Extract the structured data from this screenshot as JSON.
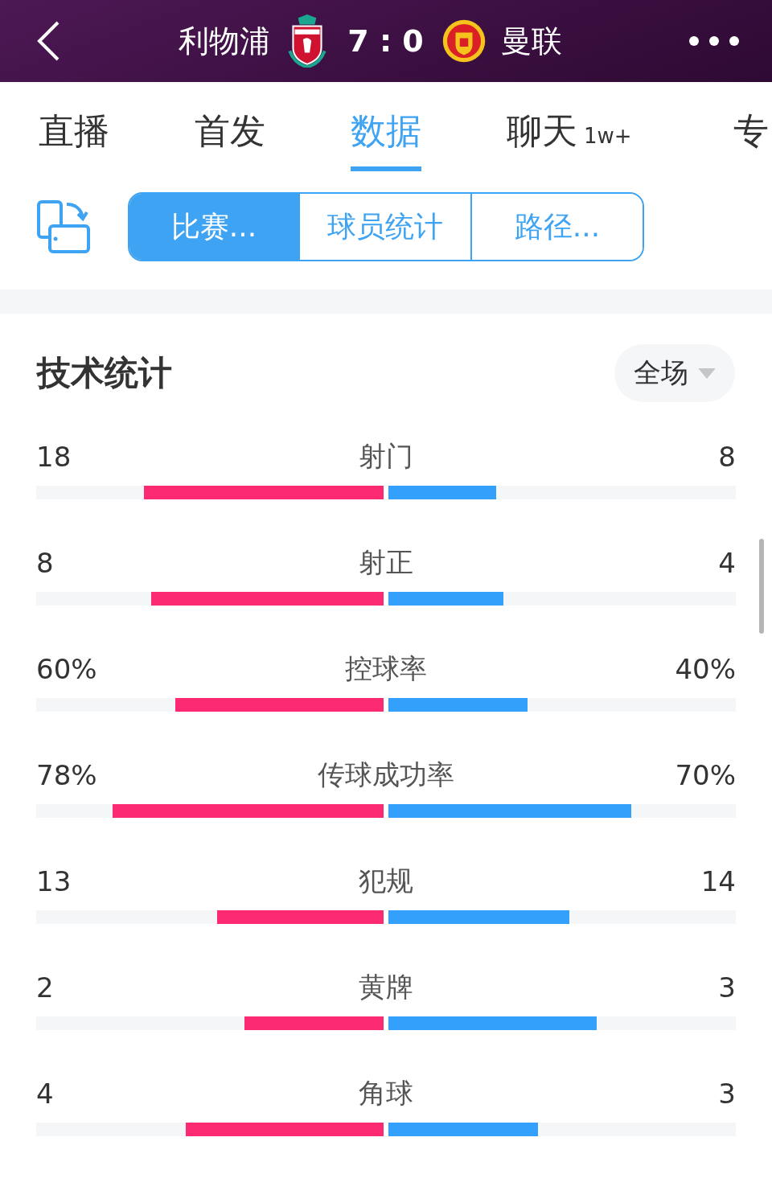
{
  "header": {
    "home_team": "利物浦",
    "score": "7 : 0",
    "away_team": "曼联"
  },
  "tabs": [
    {
      "label": "直播",
      "selected": false
    },
    {
      "label": "首发",
      "selected": false
    },
    {
      "label": "数据",
      "selected": true
    },
    {
      "label": "聊天",
      "badge": "1w+",
      "selected": false
    },
    {
      "label": "专",
      "selected": false
    }
  ],
  "segments": [
    {
      "label": "比赛...",
      "selected": true
    },
    {
      "label": "球员统计",
      "selected": false
    },
    {
      "label": "路径...",
      "selected": false
    }
  ],
  "section": {
    "title": "技术统计",
    "period_dropdown": "全场"
  },
  "stats": [
    {
      "label": "射门",
      "home": {
        "value": "18",
        "level": 0.69
      },
      "away": {
        "value": "8",
        "level": 0.31
      }
    },
    {
      "label": "射正",
      "home": {
        "value": "8",
        "level": 0.67
      },
      "away": {
        "value": "4",
        "level": 0.33
      }
    },
    {
      "label": "控球率",
      "home": {
        "value": "60%",
        "level": 0.6
      },
      "away": {
        "value": "40%",
        "level": 0.4
      }
    },
    {
      "label": "传球成功率",
      "home": {
        "value": "78%",
        "level": 0.78
      },
      "away": {
        "value": "70%",
        "level": 0.7
      }
    },
    {
      "label": "犯规",
      "home": {
        "value": "13",
        "level": 0.48
      },
      "away": {
        "value": "14",
        "level": 0.52
      }
    },
    {
      "label": "黄牌",
      "home": {
        "value": "2",
        "level": 0.4
      },
      "away": {
        "value": "3",
        "level": 0.6
      }
    },
    {
      "label": "角球",
      "home": {
        "value": "4",
        "level": 0.57
      },
      "away": {
        "value": "3",
        "level": 0.43
      }
    }
  ]
}
